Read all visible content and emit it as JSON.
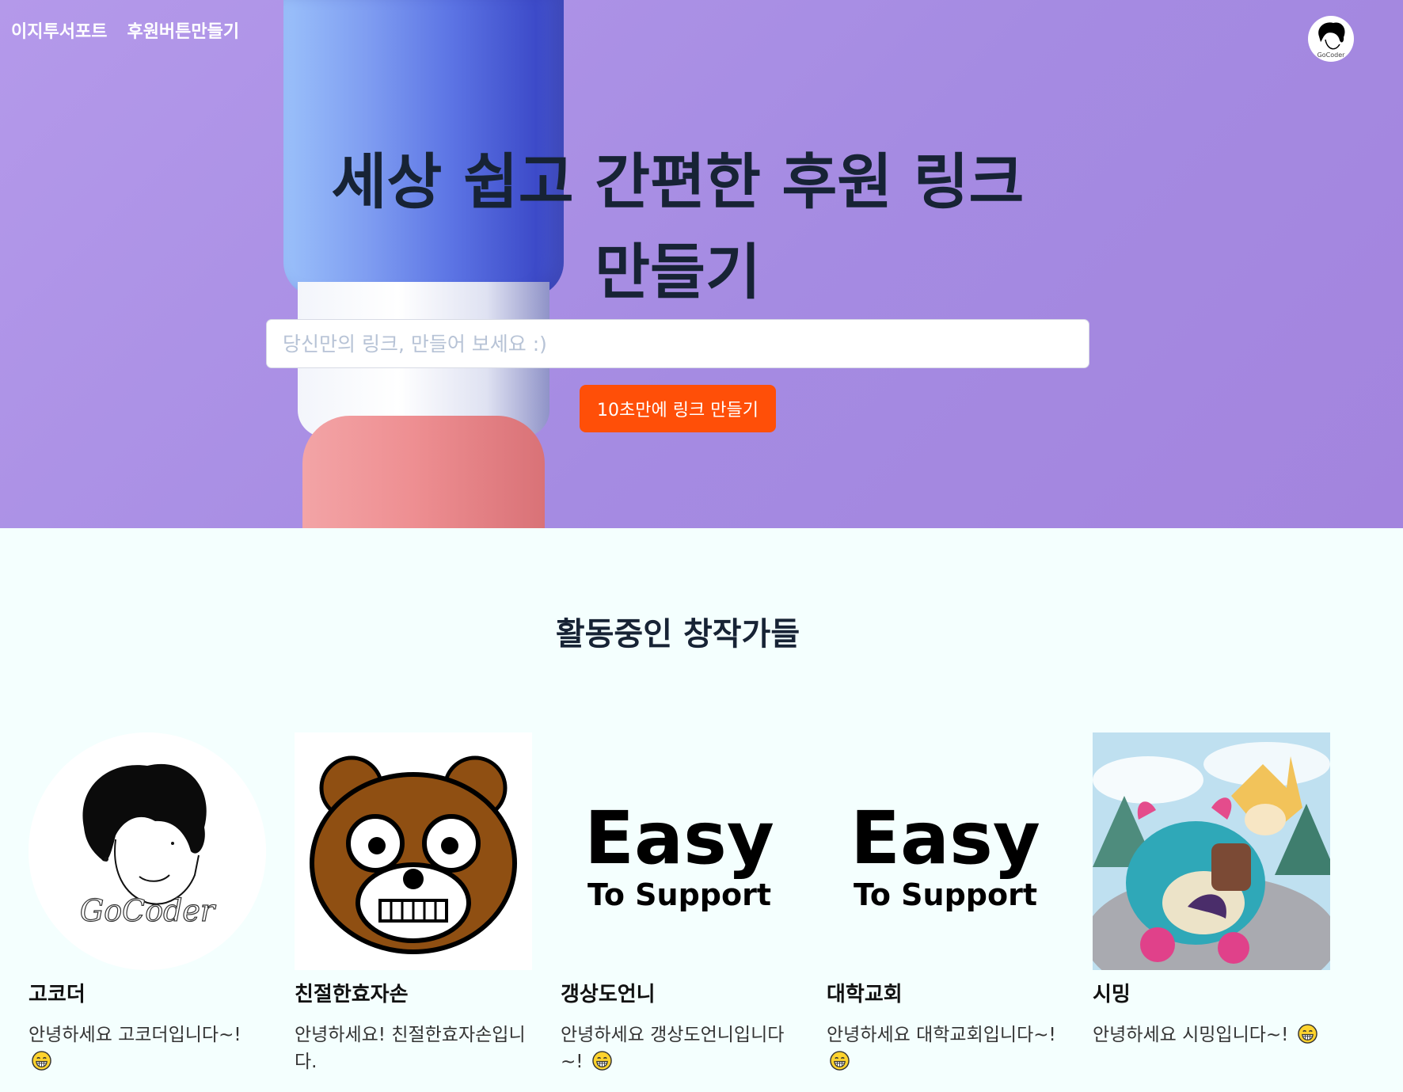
{
  "nav": {
    "brand": "이지투서포트",
    "make_button_link": "후원버튼만들기"
  },
  "hero": {
    "title_line1": "세상 쉽고 간편한 후원 링크",
    "title_line2": "만들기",
    "input_placeholder": "당신만의 링크, 만들어 보세요 :)",
    "input_value": "",
    "cta_label": "10초만에 링크 만들기"
  },
  "creators_section": {
    "title": "활동중인 창작가들",
    "items": [
      {
        "name": "고코더",
        "desc": "안녕하세요 고코더입니다~!",
        "emoji": "grinning-face-icon",
        "image_text": "GoCoder"
      },
      {
        "name": "친절한효자손",
        "desc": "안녕하세요! 친절한효자손입니다.",
        "emoji": "",
        "image_text": ""
      },
      {
        "name": "갱상도언니",
        "desc": "안녕하세요 갱상도언니입니다~!",
        "emoji": "grinning-face-icon",
        "image_text": "Easy To Support"
      },
      {
        "name": "대학교회",
        "desc": "안녕하세요 대학교회입니다~!",
        "emoji": "grinning-face-icon",
        "image_text": "Easy To Support"
      },
      {
        "name": "시밍",
        "desc": "안녕하세요 시밍입니다~!",
        "emoji": "grinning-face-icon",
        "image_text": ""
      }
    ]
  },
  "logos": {
    "easy_word": "Easy",
    "support_words": "To Support",
    "gocoder_signature": "GoCoder"
  },
  "colors": {
    "hero_bg": "#a88de4",
    "title_text": "#172335",
    "cta_bg": "#ff4f08",
    "page_bg": "#f4fffe"
  }
}
